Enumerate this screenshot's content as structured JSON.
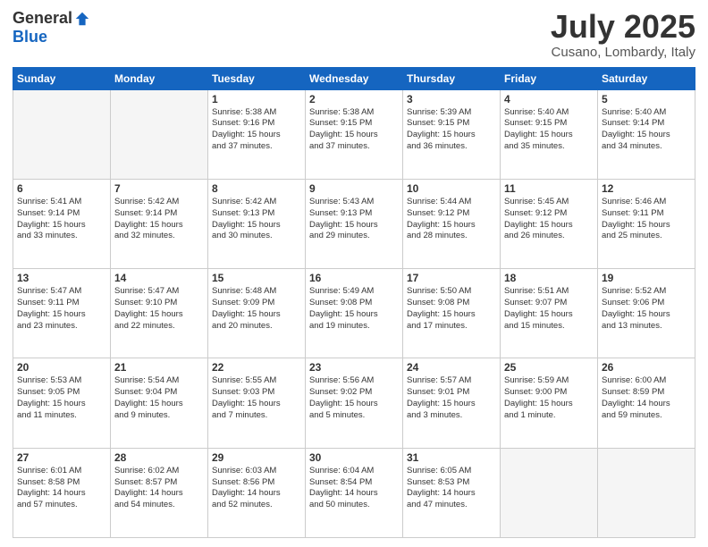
{
  "header": {
    "logo_general": "General",
    "logo_blue": "Blue",
    "month_title": "July 2025",
    "location": "Cusano, Lombardy, Italy"
  },
  "weekdays": [
    "Sunday",
    "Monday",
    "Tuesday",
    "Wednesday",
    "Thursday",
    "Friday",
    "Saturday"
  ],
  "weeks": [
    [
      {
        "num": "",
        "info": ""
      },
      {
        "num": "",
        "info": ""
      },
      {
        "num": "1",
        "info": "Sunrise: 5:38 AM\nSunset: 9:16 PM\nDaylight: 15 hours\nand 37 minutes."
      },
      {
        "num": "2",
        "info": "Sunrise: 5:38 AM\nSunset: 9:15 PM\nDaylight: 15 hours\nand 37 minutes."
      },
      {
        "num": "3",
        "info": "Sunrise: 5:39 AM\nSunset: 9:15 PM\nDaylight: 15 hours\nand 36 minutes."
      },
      {
        "num": "4",
        "info": "Sunrise: 5:40 AM\nSunset: 9:15 PM\nDaylight: 15 hours\nand 35 minutes."
      },
      {
        "num": "5",
        "info": "Sunrise: 5:40 AM\nSunset: 9:14 PM\nDaylight: 15 hours\nand 34 minutes."
      }
    ],
    [
      {
        "num": "6",
        "info": "Sunrise: 5:41 AM\nSunset: 9:14 PM\nDaylight: 15 hours\nand 33 minutes."
      },
      {
        "num": "7",
        "info": "Sunrise: 5:42 AM\nSunset: 9:14 PM\nDaylight: 15 hours\nand 32 minutes."
      },
      {
        "num": "8",
        "info": "Sunrise: 5:42 AM\nSunset: 9:13 PM\nDaylight: 15 hours\nand 30 minutes."
      },
      {
        "num": "9",
        "info": "Sunrise: 5:43 AM\nSunset: 9:13 PM\nDaylight: 15 hours\nand 29 minutes."
      },
      {
        "num": "10",
        "info": "Sunrise: 5:44 AM\nSunset: 9:12 PM\nDaylight: 15 hours\nand 28 minutes."
      },
      {
        "num": "11",
        "info": "Sunrise: 5:45 AM\nSunset: 9:12 PM\nDaylight: 15 hours\nand 26 minutes."
      },
      {
        "num": "12",
        "info": "Sunrise: 5:46 AM\nSunset: 9:11 PM\nDaylight: 15 hours\nand 25 minutes."
      }
    ],
    [
      {
        "num": "13",
        "info": "Sunrise: 5:47 AM\nSunset: 9:11 PM\nDaylight: 15 hours\nand 23 minutes."
      },
      {
        "num": "14",
        "info": "Sunrise: 5:47 AM\nSunset: 9:10 PM\nDaylight: 15 hours\nand 22 minutes."
      },
      {
        "num": "15",
        "info": "Sunrise: 5:48 AM\nSunset: 9:09 PM\nDaylight: 15 hours\nand 20 minutes."
      },
      {
        "num": "16",
        "info": "Sunrise: 5:49 AM\nSunset: 9:08 PM\nDaylight: 15 hours\nand 19 minutes."
      },
      {
        "num": "17",
        "info": "Sunrise: 5:50 AM\nSunset: 9:08 PM\nDaylight: 15 hours\nand 17 minutes."
      },
      {
        "num": "18",
        "info": "Sunrise: 5:51 AM\nSunset: 9:07 PM\nDaylight: 15 hours\nand 15 minutes."
      },
      {
        "num": "19",
        "info": "Sunrise: 5:52 AM\nSunset: 9:06 PM\nDaylight: 15 hours\nand 13 minutes."
      }
    ],
    [
      {
        "num": "20",
        "info": "Sunrise: 5:53 AM\nSunset: 9:05 PM\nDaylight: 15 hours\nand 11 minutes."
      },
      {
        "num": "21",
        "info": "Sunrise: 5:54 AM\nSunset: 9:04 PM\nDaylight: 15 hours\nand 9 minutes."
      },
      {
        "num": "22",
        "info": "Sunrise: 5:55 AM\nSunset: 9:03 PM\nDaylight: 15 hours\nand 7 minutes."
      },
      {
        "num": "23",
        "info": "Sunrise: 5:56 AM\nSunset: 9:02 PM\nDaylight: 15 hours\nand 5 minutes."
      },
      {
        "num": "24",
        "info": "Sunrise: 5:57 AM\nSunset: 9:01 PM\nDaylight: 15 hours\nand 3 minutes."
      },
      {
        "num": "25",
        "info": "Sunrise: 5:59 AM\nSunset: 9:00 PM\nDaylight: 15 hours\nand 1 minute."
      },
      {
        "num": "26",
        "info": "Sunrise: 6:00 AM\nSunset: 8:59 PM\nDaylight: 14 hours\nand 59 minutes."
      }
    ],
    [
      {
        "num": "27",
        "info": "Sunrise: 6:01 AM\nSunset: 8:58 PM\nDaylight: 14 hours\nand 57 minutes."
      },
      {
        "num": "28",
        "info": "Sunrise: 6:02 AM\nSunset: 8:57 PM\nDaylight: 14 hours\nand 54 minutes."
      },
      {
        "num": "29",
        "info": "Sunrise: 6:03 AM\nSunset: 8:56 PM\nDaylight: 14 hours\nand 52 minutes."
      },
      {
        "num": "30",
        "info": "Sunrise: 6:04 AM\nSunset: 8:54 PM\nDaylight: 14 hours\nand 50 minutes."
      },
      {
        "num": "31",
        "info": "Sunrise: 6:05 AM\nSunset: 8:53 PM\nDaylight: 14 hours\nand 47 minutes."
      },
      {
        "num": "",
        "info": ""
      },
      {
        "num": "",
        "info": ""
      }
    ]
  ]
}
